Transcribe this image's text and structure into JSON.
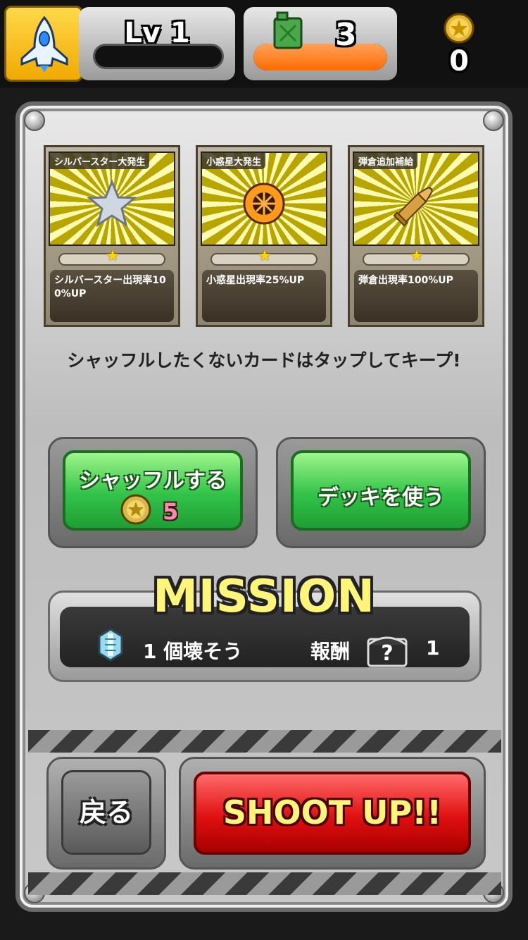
{
  "hud": {
    "level_label": "Lv 1",
    "fuel_count": "3",
    "fuel_level": 1.0,
    "coin_count": "0",
    "icons": {
      "ship": "rocket-icon",
      "fuel": "fuel-can-icon",
      "coin": "star-coin-icon"
    }
  },
  "cards": [
    {
      "title": "シルバースター大発生",
      "description": "シルバースター出現率100%UP",
      "stars": 1,
      "art": "silver-star-icon"
    },
    {
      "title": "小惑星大発生",
      "description": "小惑星出現率25%UP",
      "stars": 1,
      "art": "asteroid-icon"
    },
    {
      "title": "弾倉追加補給",
      "description": "弾倉出現率100%UP",
      "stars": 1,
      "art": "bullet-icon"
    }
  ],
  "hint": "シャッフルしたくないカードはタップしてキープ!",
  "buttons": {
    "shuffle_label": "シャッフルする",
    "shuffle_cost": "5",
    "deck_label": "デッキを使う",
    "back_label": "戻る",
    "shoot_label": "SHOOT UP!!"
  },
  "mission": {
    "title": "MISSION",
    "objective": "1 個壊そう",
    "reward_label": "報酬",
    "reward_count": "1",
    "icons": {
      "objective": "crystal-icon",
      "reward": "mystery-chest-icon"
    }
  },
  "colors": {
    "accent_yellow": "#fff57a",
    "green_button": "#33c34a",
    "red_button": "#e01010",
    "fuel_orange": "#ff6a00"
  }
}
